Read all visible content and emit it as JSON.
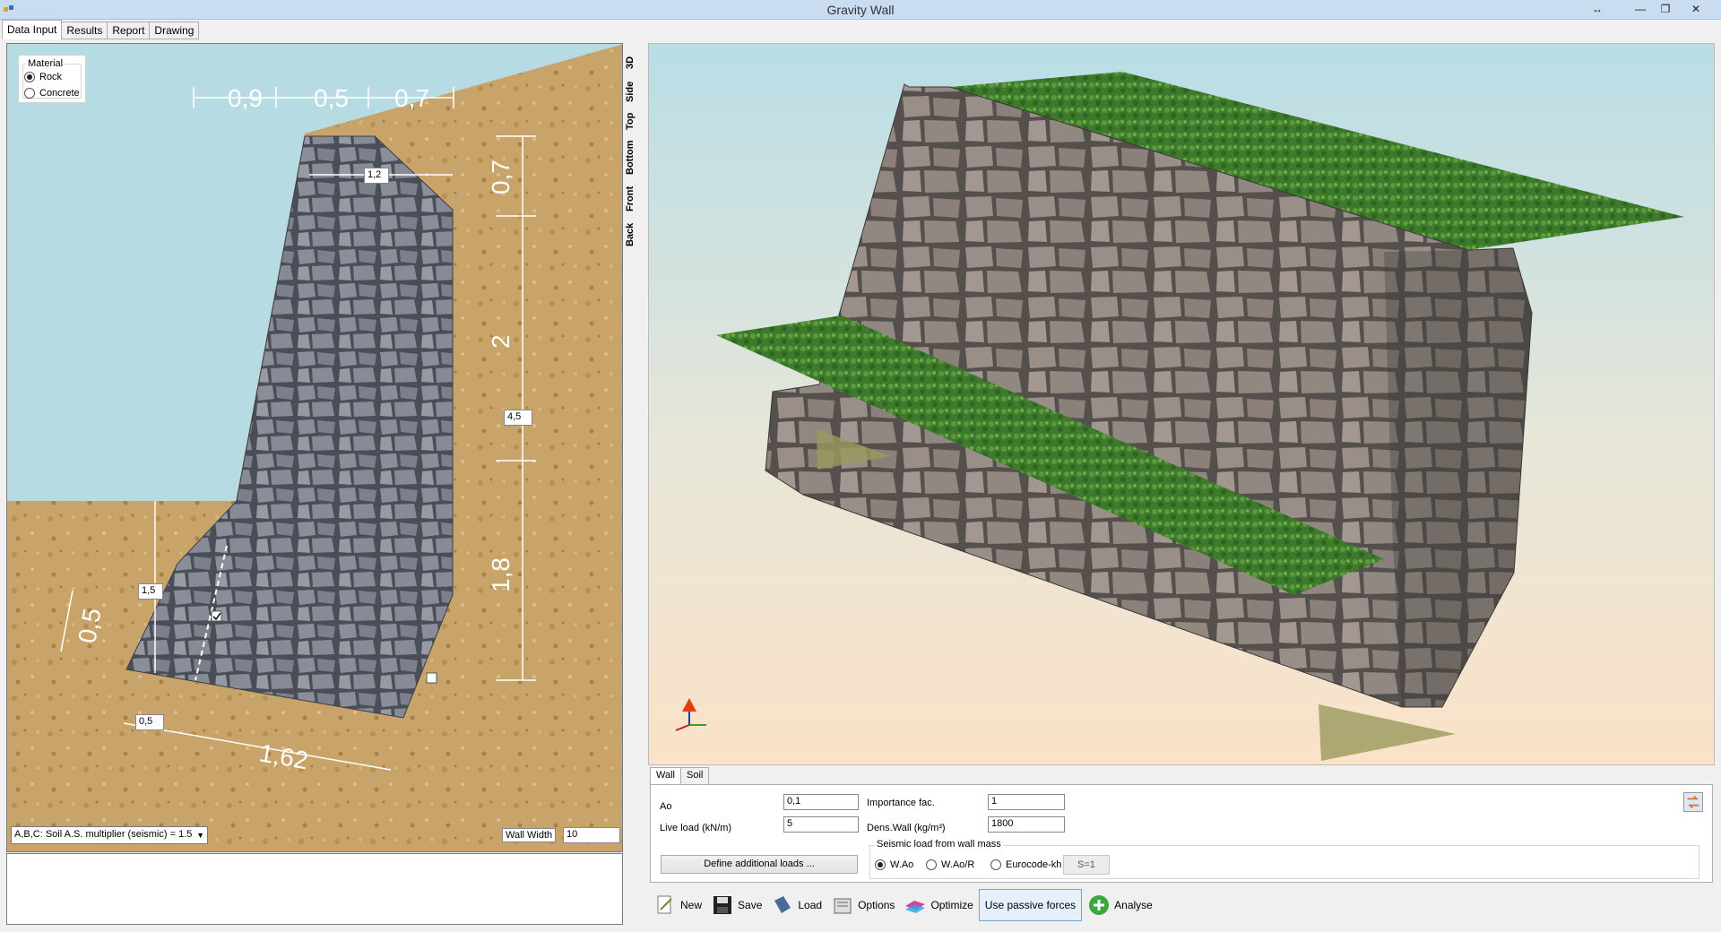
{
  "window": {
    "title": "Gravity Wall",
    "resize_glyph": "↔",
    "min_glyph": "—",
    "restore_glyph": "❐",
    "close_glyph": "✕"
  },
  "main_tabs": [
    "Data Input",
    "Results",
    "Report",
    "Drawing"
  ],
  "material": {
    "legend": "Material",
    "options": [
      "Rock",
      "Concrete"
    ],
    "selected": "Rock"
  },
  "drawing": {
    "dims_top": [
      "0,9",
      "0,5",
      "0,7"
    ],
    "dims_right": [
      "0,7",
      "2",
      "1,8"
    ],
    "dim_left": "0,5",
    "dim_bottom": "1,62",
    "inputs": {
      "top_width": "1,2",
      "height": "4,5",
      "soil_height": "1,5",
      "toe": "0,5"
    }
  },
  "soil_select": {
    "value": "A,B,C: Soil A.S. multiplier (seismic) = 1.5"
  },
  "wall_width": {
    "label": "Wall Width",
    "value": "10"
  },
  "view_tabs": [
    "3D",
    "Side",
    "Top",
    "Bottom",
    "Front",
    "Back"
  ],
  "param_tabs": [
    "Wall",
    "Soil"
  ],
  "params": {
    "ao": {
      "label": "Ao",
      "value": "0,1"
    },
    "live_load": {
      "label": "Live load (kN/m)",
      "value": "5"
    },
    "importance": {
      "label": "Importance fac.",
      "value": "1"
    },
    "dens_wall": {
      "label": "Dens.Wall (kg/m³)",
      "value": "1800"
    },
    "define_loads": "Define additional loads ...",
    "seismic": {
      "legend": "Seismic load from wall mass",
      "options": [
        "W.Ao",
        "W.Ao/R",
        "Eurocode-kh"
      ],
      "selected": "W.Ao",
      "s_button": "S=1"
    }
  },
  "toolbar": [
    "New",
    "Save",
    "Load",
    "Options",
    "Optimize",
    "Use passive forces",
    "Analyse"
  ]
}
